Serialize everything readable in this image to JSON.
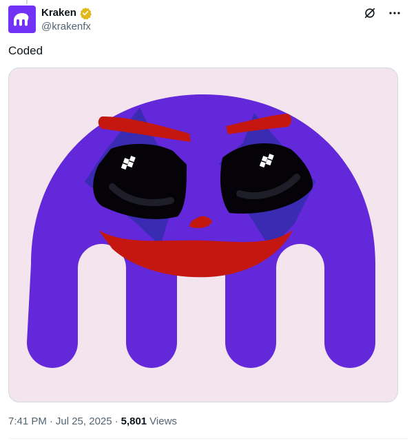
{
  "tweet": {
    "author": {
      "display_name": "Kraken",
      "handle": "@krakenfx",
      "verified": true,
      "verified_badge_color": "#e2b719",
      "avatar_color": "#7132f5",
      "avatar_icon": "kraken-logo-icon"
    },
    "text": "Coded",
    "media": {
      "background_color": "#f3e4ee",
      "logo_color": "#6228d9",
      "paint_red": "#c41710",
      "makeup_blue": "#3a2bb3"
    },
    "meta": {
      "time": "7:41 PM",
      "separator": "·",
      "date": "Jul 25, 2025",
      "views_count": "5,801",
      "views_label": "Views"
    },
    "actions": {
      "grok_icon": "grok-icon",
      "more_icon": "more-icon"
    }
  }
}
